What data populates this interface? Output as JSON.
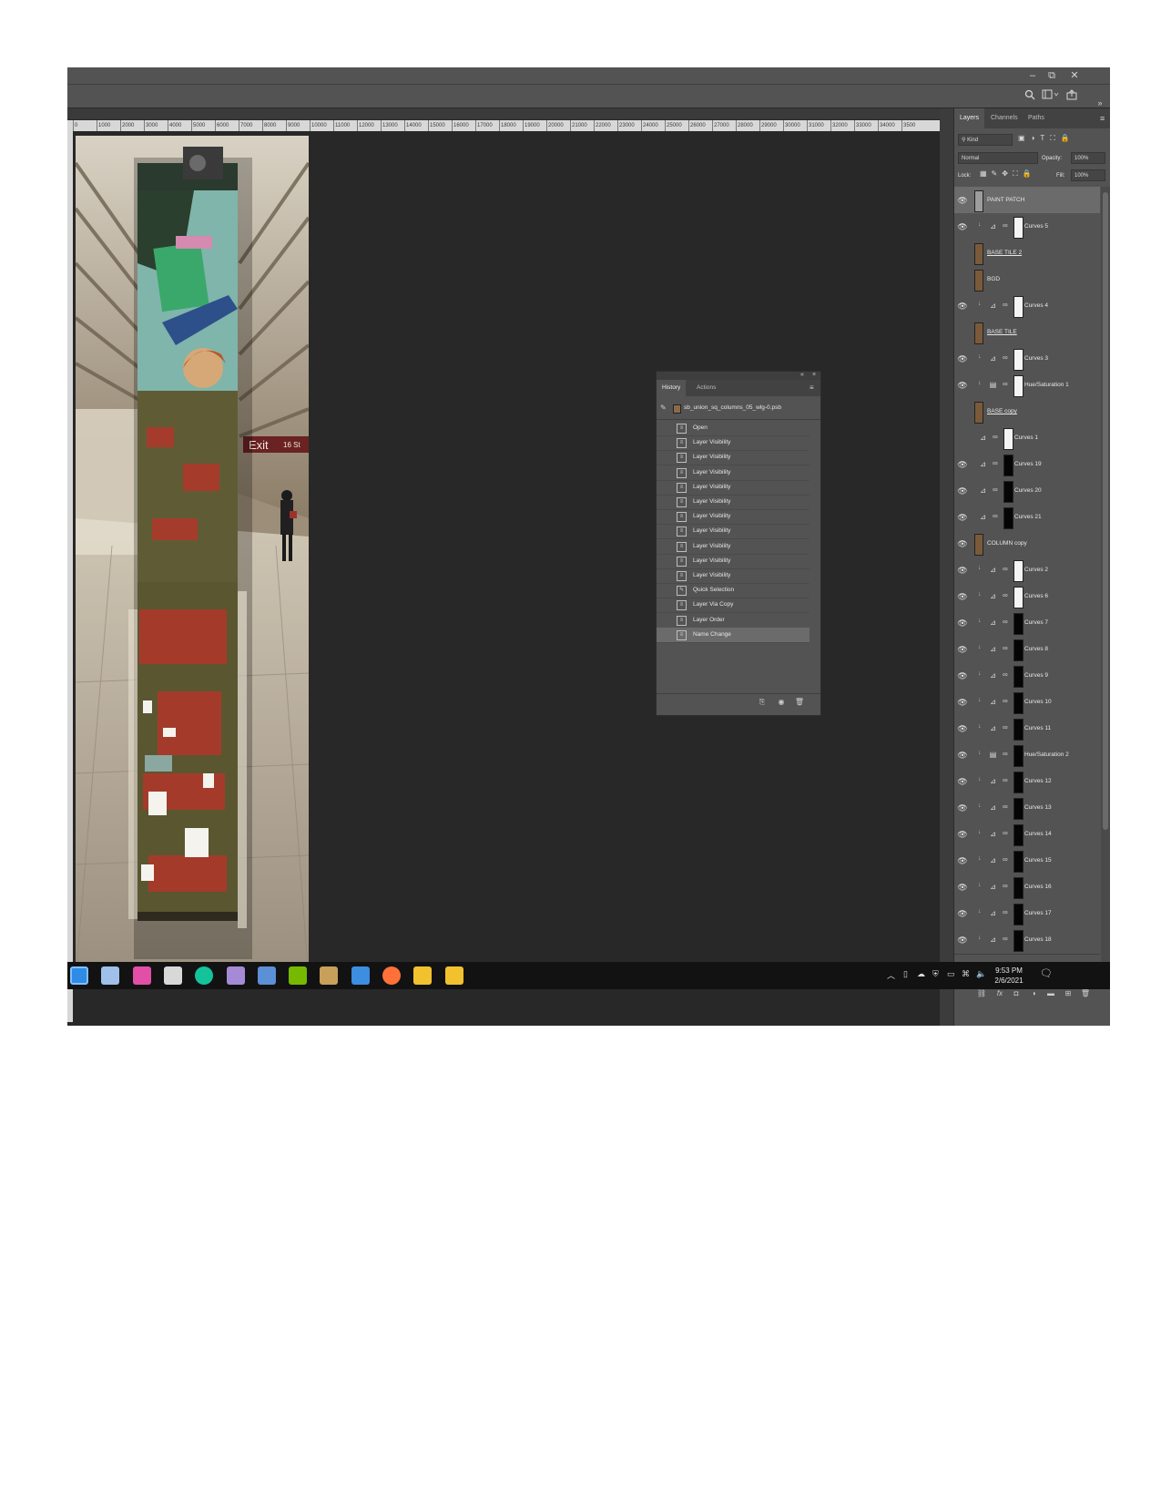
{
  "window": {
    "minimize": "–",
    "restore": "⧉",
    "close": "✕"
  },
  "options_bar": {
    "search_icon": "search-icon",
    "workspace_icon": "workspace-icon",
    "share_icon": "share-icon",
    "collapse": "»"
  },
  "ruler": {
    "ticks": [
      "0",
      "1000",
      "2000",
      "3000",
      "4000",
      "5000",
      "6000",
      "7000",
      "8000",
      "9000",
      "10000",
      "11000",
      "12000",
      "13000",
      "14000",
      "15000",
      "16000",
      "17000",
      "18000",
      "19000",
      "20000",
      "21000",
      "22000",
      "23000",
      "24000",
      "25000",
      "26000",
      "27000",
      "28000",
      "29000",
      "30000",
      "31000",
      "32000",
      "33000",
      "34000",
      "3500"
    ]
  },
  "layers_panel": {
    "tabs": [
      "Layers",
      "Channels",
      "Paths"
    ],
    "filter_label": "Kind",
    "blend_mode": "Normal",
    "opacity_label": "Opacity:",
    "opacity_value": "100%",
    "lock_label": "Lock:",
    "fill_label": "Fill:",
    "fill_value": "100%",
    "layers": [
      {
        "name": "PAINT PATCH",
        "visible": true,
        "kind": "pixel",
        "selected": true
      },
      {
        "name": "Curves 5",
        "visible": true,
        "kind": "curves",
        "clip": true,
        "mask": "white"
      },
      {
        "name": "BASE TILE 2",
        "visible": false,
        "kind": "pixel",
        "underline": true
      },
      {
        "name": "BGD",
        "visible": false,
        "kind": "pixel"
      },
      {
        "name": "Curves 4",
        "visible": true,
        "kind": "curves",
        "clip": true,
        "mask": "white"
      },
      {
        "name": "BASE TILE",
        "visible": false,
        "kind": "pixel",
        "underline": true
      },
      {
        "name": "Curves 3",
        "visible": true,
        "kind": "curves",
        "clip": true,
        "mask": "white"
      },
      {
        "name": "Hue/Saturation 1",
        "visible": true,
        "kind": "hue",
        "clip": true,
        "mask": "white"
      },
      {
        "name": "BASE copy",
        "visible": false,
        "kind": "pixel",
        "underline": true
      },
      {
        "name": "Curves 1",
        "visible": false,
        "kind": "curves",
        "mask": "white"
      },
      {
        "name": "Curves 19",
        "visible": true,
        "kind": "curves",
        "mask": "black"
      },
      {
        "name": "Curves 20",
        "visible": true,
        "kind": "curves",
        "mask": "black"
      },
      {
        "name": "Curves 21",
        "visible": true,
        "kind": "curves",
        "mask": "black"
      },
      {
        "name": "COLUMN copy",
        "visible": true,
        "kind": "pixel"
      },
      {
        "name": "Curves 2",
        "visible": true,
        "kind": "curves",
        "clip": true,
        "mask": "white"
      },
      {
        "name": "Curves 6",
        "visible": true,
        "kind": "curves",
        "clip": true,
        "mask": "white"
      },
      {
        "name": "Curves 7",
        "visible": true,
        "kind": "curves",
        "clip": true,
        "mask": "black"
      },
      {
        "name": "Curves 8",
        "visible": true,
        "kind": "curves",
        "clip": true,
        "mask": "black"
      },
      {
        "name": "Curves 9",
        "visible": true,
        "kind": "curves",
        "clip": true,
        "mask": "black"
      },
      {
        "name": "Curves 10",
        "visible": true,
        "kind": "curves",
        "clip": true,
        "mask": "black"
      },
      {
        "name": "Curves 11",
        "visible": true,
        "kind": "curves",
        "clip": true,
        "mask": "black"
      },
      {
        "name": "Hue/Saturation 2",
        "visible": true,
        "kind": "hue",
        "clip": true,
        "mask": "black"
      },
      {
        "name": "Curves 12",
        "visible": true,
        "kind": "curves",
        "clip": true,
        "mask": "black"
      },
      {
        "name": "Curves 13",
        "visible": true,
        "kind": "curves",
        "clip": true,
        "mask": "black"
      },
      {
        "name": "Curves 14",
        "visible": true,
        "kind": "curves",
        "clip": true,
        "mask": "black"
      },
      {
        "name": "Curves 15",
        "visible": true,
        "kind": "curves",
        "clip": true,
        "mask": "black"
      },
      {
        "name": "Curves 16",
        "visible": true,
        "kind": "curves",
        "clip": true,
        "mask": "black"
      },
      {
        "name": "Curves 17",
        "visible": true,
        "kind": "curves",
        "clip": true,
        "mask": "black"
      },
      {
        "name": "Curves 18",
        "visible": true,
        "kind": "curves",
        "clip": true,
        "mask": "black"
      }
    ]
  },
  "history_panel": {
    "tabs": [
      "History",
      "Actions"
    ],
    "snapshot": "sb_union_sq_columns_05_wlg-0.psb",
    "steps": [
      "Open",
      "Layer Visibility",
      "Layer Visibility",
      "Layer Visibility",
      "Layer Visibility",
      "Layer Visibility",
      "Layer Visibility",
      "Layer Visibility",
      "Layer Visibility",
      "Layer Visibility",
      "Layer Visibility",
      "Quick Selection",
      "Layer Via Copy",
      "Layer Order",
      "Name Change"
    ],
    "selected_step": "Name Change"
  },
  "canvas": {
    "sign_text": "Exit",
    "sign_text_2": "16 St"
  },
  "taskbar": {
    "time": "9:53 PM",
    "date": "2/6/2021",
    "icons": [
      "app-launcher-icon",
      "edge-icon",
      "photos-icon",
      "calendar-icon",
      "grammarly-icon",
      "app-icon",
      "calculator-icon",
      "nvidia-icon",
      "app-icon-2",
      "task-view-icon",
      "firefox-icon",
      "duck-icon",
      "duck-icon-2"
    ],
    "icon_colors": [
      "#2f8be6",
      "#9fc0e8",
      "#e24fa7",
      "#d8d8d8",
      "#15c39a",
      "#a58bd6",
      "#5b8fd6",
      "#76b900",
      "#c8a05a",
      "#3d8de0",
      "#ff7139",
      "#f2c12e",
      "#f2c12e"
    ]
  },
  "colors": {
    "workspace": "#282828",
    "panel": "#535353",
    "selected": "#6b6b6b"
  }
}
